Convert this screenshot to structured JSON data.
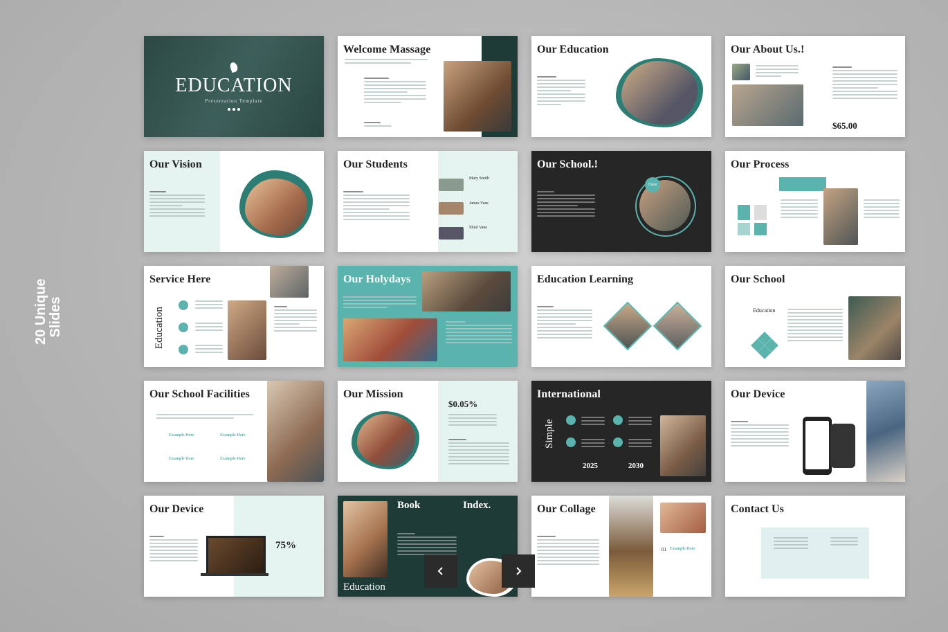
{
  "side_label": {
    "line1": "20 Unique",
    "line2": "Slides"
  },
  "cover": {
    "title": "EDUCATION",
    "subtitle": "Presentation Template"
  },
  "slides": {
    "welcome": "Welcome Massage",
    "education": "Our Education",
    "about": "Our About Us.!",
    "about_price": "$65.00",
    "vision": "Our Vision",
    "students": "Our Students",
    "student_names": [
      "Mary Smith",
      "James Vans",
      "Shiol Vane"
    ],
    "school": "Our School.!",
    "school_badge": "Class",
    "process": "Our Process",
    "service": "Service Here",
    "service_vertical": "Education",
    "holydays": "Our Holydays",
    "learning": "Education Learning",
    "our_school": "Our School",
    "our_school_label": "Education",
    "facilities": "Our School Facilities",
    "facilities_items": [
      "Example Here",
      "Example Here",
      "Example Here",
      "Example Here"
    ],
    "mission": "Our Mission",
    "mission_value": "$0.05%",
    "international": "International",
    "international_vertical": "Simple",
    "international_years": [
      "2025",
      "2030"
    ],
    "device": "Our Device",
    "device2": "Our Device",
    "device2_percent": "75%",
    "book": "Book",
    "index": "Index.",
    "book_footer": "Education",
    "collage": "Our Collage",
    "collage_item": "Example Here",
    "collage_number": "01",
    "contact": "Contact Us"
  },
  "nav": {
    "prev_icon": "chevron-left-icon",
    "next_icon": "chevron-right-icon"
  },
  "colors": {
    "teal": "#5bb3ad",
    "dark": "#262626",
    "dark_green": "#1f3b37",
    "light_teal": "#dff0ee"
  }
}
